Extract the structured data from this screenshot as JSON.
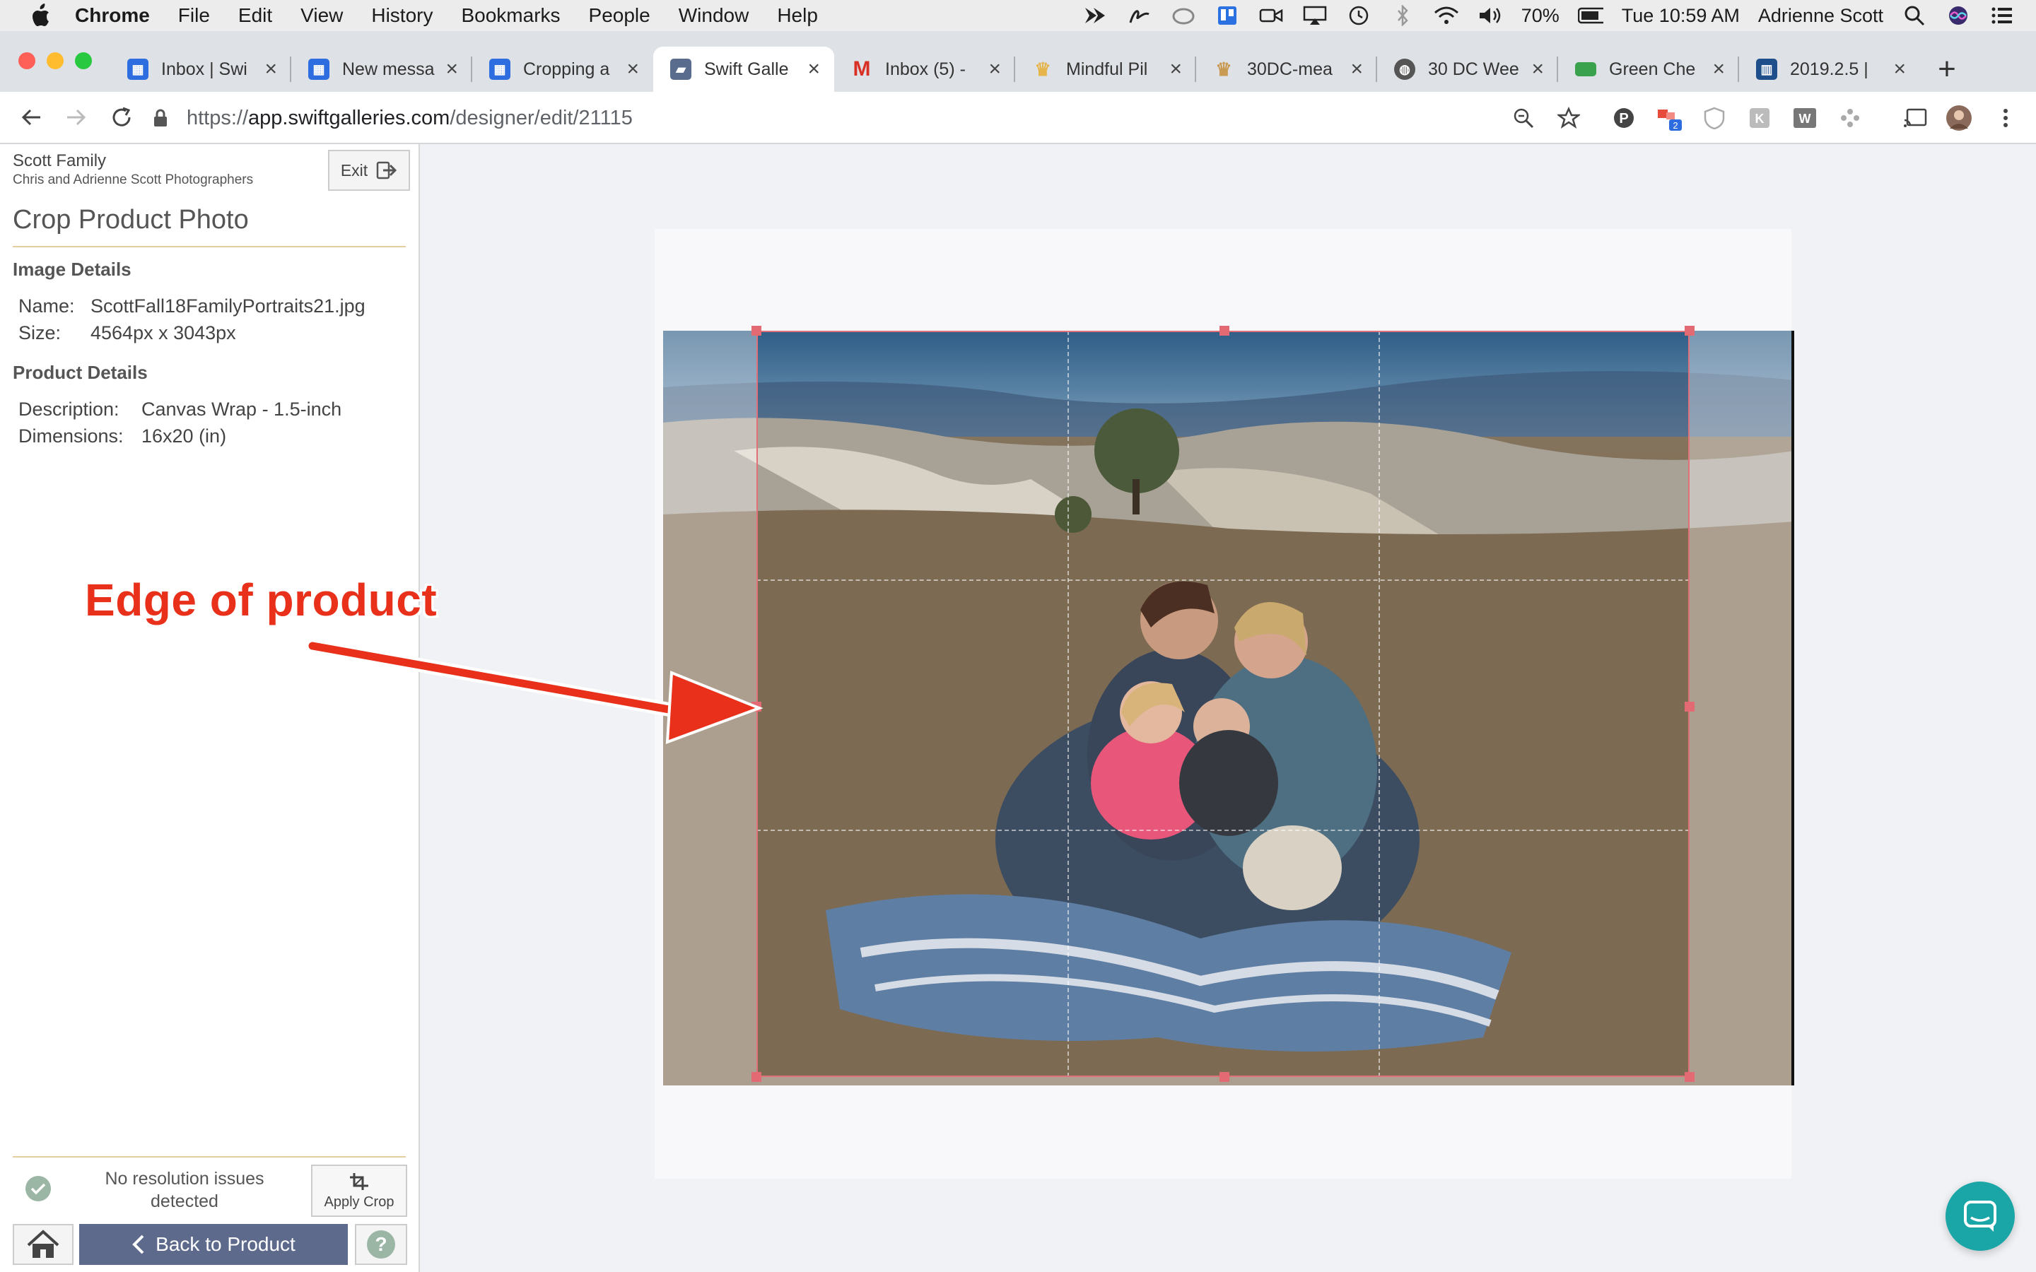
{
  "menubar": {
    "app": "Chrome",
    "items": [
      "File",
      "Edit",
      "View",
      "History",
      "Bookmarks",
      "People",
      "Window",
      "Help"
    ],
    "battery": "70%",
    "clock": "Tue 10:59 AM",
    "user": "Adrienne Scott"
  },
  "tabs": [
    {
      "title": "Inbox | Swi",
      "icon": "intercom-icon",
      "color": "#2e6de0"
    },
    {
      "title": "New messa",
      "icon": "intercom-icon",
      "color": "#2e6de0"
    },
    {
      "title": "Cropping a",
      "icon": "intercom-icon",
      "color": "#2e6de0"
    },
    {
      "title": "Swift Galle",
      "icon": "swiftgalleries-icon",
      "color": "#5a6c8e",
      "active": true
    },
    {
      "title": "Inbox (5) -",
      "icon": "gmail-icon",
      "color": "#d93025"
    },
    {
      "title": "Mindful Pil",
      "icon": "crown-icon",
      "color": "#e5b54b"
    },
    {
      "title": "30DC-mea",
      "icon": "crown-icon",
      "color": "#c99a52"
    },
    {
      "title": "30 DC Wee",
      "icon": "globe-icon",
      "color": "#555555"
    },
    {
      "title": "Green Che",
      "icon": "greenchef-icon",
      "color": "#3aa24c"
    },
    {
      "title": "2019.2.5 |",
      "icon": "trello-icon",
      "color": "#1e4f8a"
    }
  ],
  "address": {
    "scheme": "https://",
    "domain": "app.swiftgalleries.com",
    "path": "/designer/edit/21115"
  },
  "sidebar": {
    "client_name": "Scott Family",
    "studio_name": "Chris and Adrienne Scott Photographers",
    "exit_label": "Exit",
    "panel_title": "Crop Product Photo",
    "image_details_heading": "Image Details",
    "name_label": "Name:",
    "name_value": "ScottFall18FamilyPortraits21.jpg",
    "size_label": "Size:",
    "size_value": "4564px x 3043px",
    "product_details_heading": "Product Details",
    "description_label": "Description:",
    "description_value": "Canvas Wrap - 1.5-inch",
    "dimensions_label": "Dimensions:",
    "dimensions_value": "16x20 (in)",
    "resolution_status": "No resolution issues detected",
    "apply_crop_label": "Apply Crop",
    "back_label": "Back to Product",
    "help_label": "?"
  },
  "annotation": {
    "text": "Edge of product"
  },
  "colors": {
    "crop_border": "#e0707a",
    "back_button": "#5e6a8c",
    "annotation": "#e8301b",
    "chat": "#1aa6a6"
  }
}
